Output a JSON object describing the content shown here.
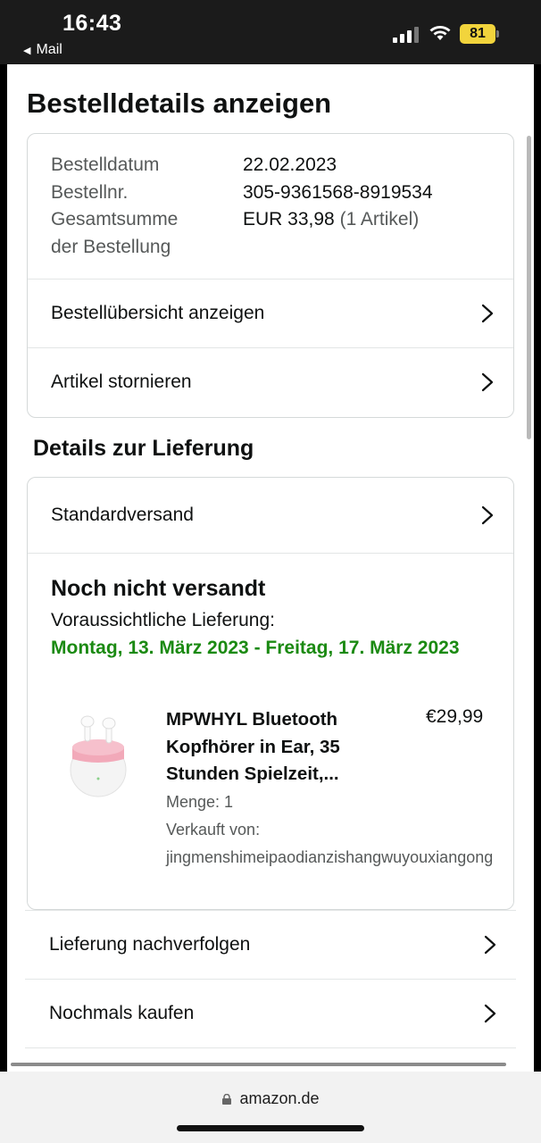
{
  "status_bar": {
    "time": "16:43",
    "back_app": "Mail",
    "battery": "81"
  },
  "page": {
    "title": "Bestelldetails anzeigen"
  },
  "order_summary": {
    "rows": [
      {
        "label": "Bestelldatum",
        "value": "22.02.2023"
      },
      {
        "label": "Bestellnr.",
        "value": "305-9361568-8919534"
      },
      {
        "label": "Gesamtsumme der Bestellung",
        "value": "EUR 33,98",
        "suffix": "(1 Artikel)"
      }
    ],
    "label_line1": "Gesamtsumme",
    "label_line2": "der Bestellung"
  },
  "order_actions": [
    {
      "label": "Bestellübersicht anzeigen"
    },
    {
      "label": "Artikel stornieren"
    }
  ],
  "delivery": {
    "section_title": "Details zur Lieferung",
    "shipping_method": "Standardversand",
    "status": "Noch nicht versandt",
    "eta_label": "Voraussichtliche Lieferung:",
    "eta_value": "Montag, 13. März 2023 - Freitag, 17. März 2023",
    "eta_color": "#1b8a12",
    "product": {
      "title": "MPWHYL Bluetooth Kopfhörer in Ear, 35 Stunden Spielzeit,...",
      "price": "€29,99",
      "quantity": "Menge: 1",
      "sold_by_label": "Verkauft von:",
      "seller": "jingmenshimeipaodianzishangwuyouxiangong"
    }
  },
  "bottom_actions": [
    {
      "label": "Lieferung nachverfolgen"
    },
    {
      "label": "Nochmals kaufen"
    }
  ],
  "browser": {
    "url": "amazon.de"
  }
}
